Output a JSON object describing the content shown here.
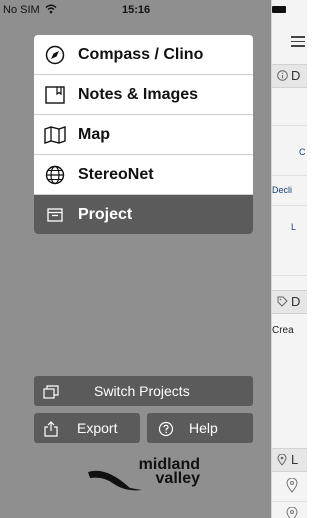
{
  "status_bar": {
    "carrier": "No SIM",
    "wifi_icon": "wifi-icon",
    "time": "15:16"
  },
  "menu": {
    "items": [
      {
        "label": "Compass / Clino",
        "icon": "compass-icon"
      },
      {
        "label": "Notes & Images",
        "icon": "notebook-icon"
      },
      {
        "label": "Map",
        "icon": "map-icon"
      },
      {
        "label": "StereoNet",
        "icon": "globe-icon"
      },
      {
        "label": "Project",
        "icon": "project-box-icon",
        "selected": true
      }
    ]
  },
  "buttons": {
    "switch_projects": "Switch Projects",
    "export": "Export",
    "help": "Help"
  },
  "logo": {
    "line1": "midland",
    "line2": "valley"
  },
  "right_panel": {
    "header_d": "D",
    "text_c": "C",
    "text_decli": "Decli",
    "text_l": "L",
    "header_d2": "D",
    "text_crea": "Crea",
    "header_l": "L"
  },
  "colors": {
    "background": "#8f8f8f",
    "menu_bg": "#ffffff",
    "selected_bg": "#5b5b5b",
    "button_bg": "#5b5b5b",
    "right_text_blue": "#1d3f77"
  }
}
